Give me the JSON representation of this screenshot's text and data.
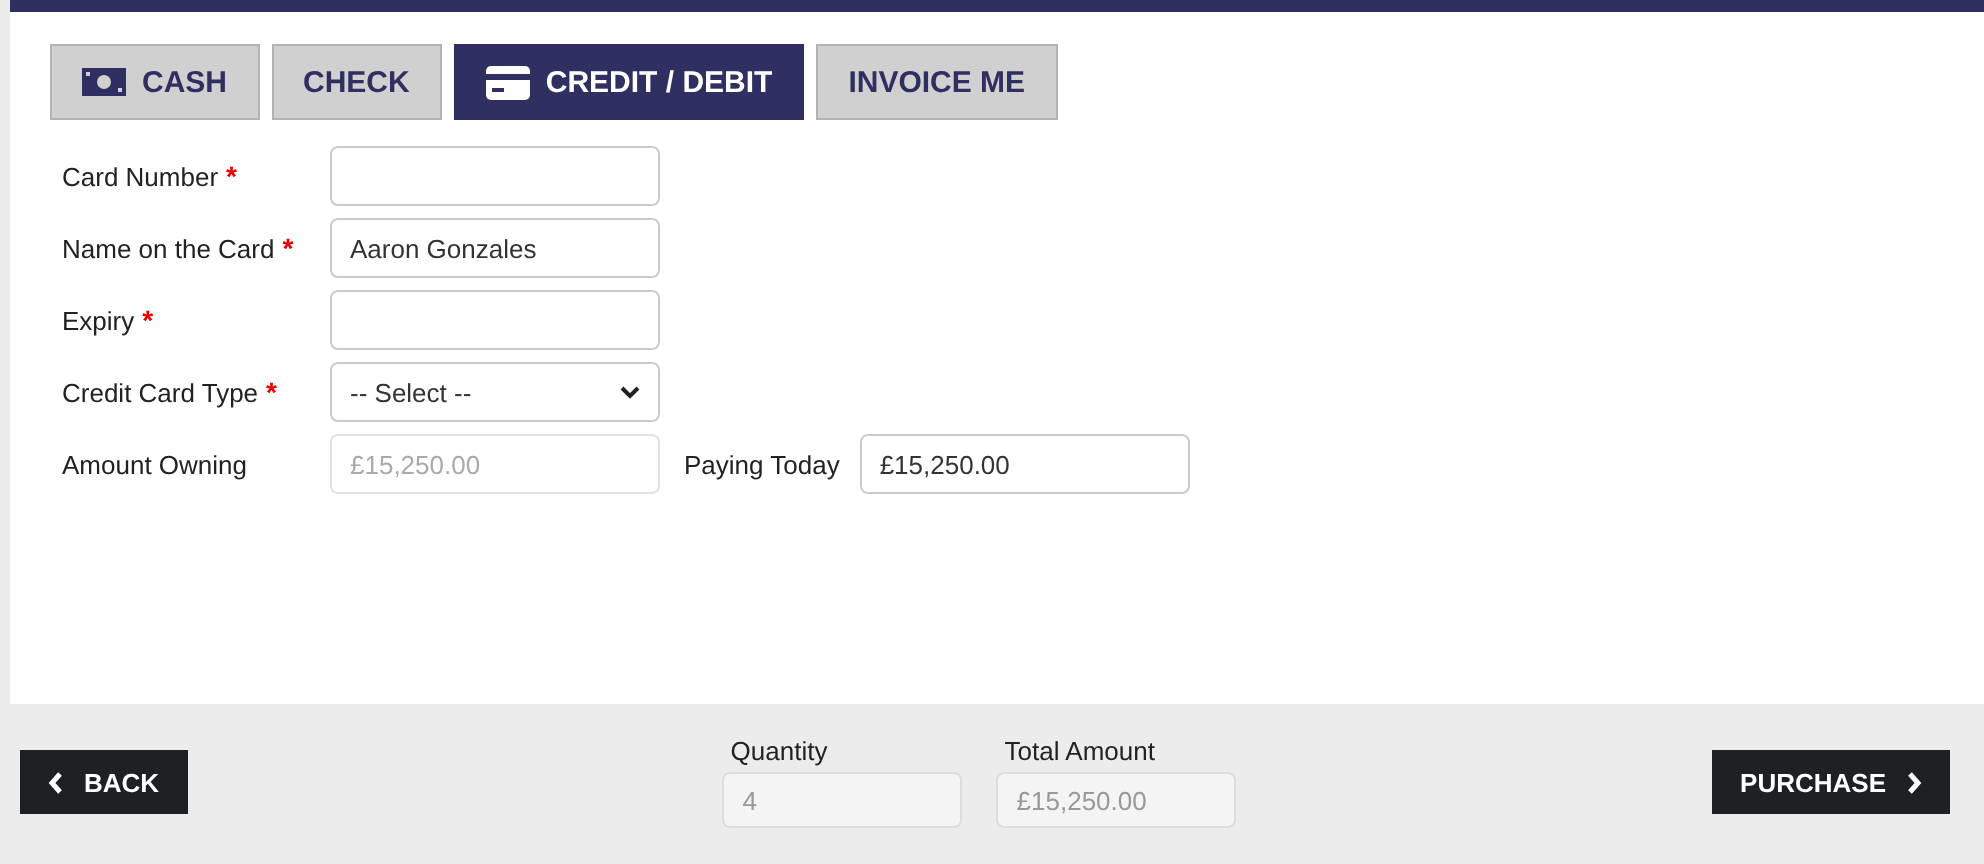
{
  "tabs": [
    {
      "label": "CASH",
      "selected": false
    },
    {
      "label": "CHECK",
      "selected": false
    },
    {
      "label": "CREDIT / DEBIT",
      "selected": true
    },
    {
      "label": "INVOICE ME",
      "selected": false
    }
  ],
  "fields": [
    {
      "label": "Card Number",
      "required_mark": "*",
      "kind": "text"
    },
    {
      "label": "Name on the Card",
      "required_mark": "*",
      "kind": "text",
      "value": "Aaron Gonzales"
    },
    {
      "label": "Expiry",
      "required_mark": "*",
      "kind": "text"
    },
    {
      "label": "Credit Card Type",
      "required_mark": "*",
      "kind": "select",
      "value": "-- Select --"
    },
    {
      "label": "Amount Owning",
      "kind": "text",
      "value": "£15,250.00",
      "disabled": true,
      "extra": {
        "label": "Paying Today",
        "value": "£15,250.00",
        "disabled": false
      }
    }
  ],
  "footer": {
    "back": "BACK",
    "purchase": "PURCHASE",
    "totals": [
      {
        "label": "Quantity",
        "value": "4",
        "disabled": true
      },
      {
        "label": "Total Amount",
        "value": "£15,250.00",
        "disabled": true
      }
    ]
  }
}
